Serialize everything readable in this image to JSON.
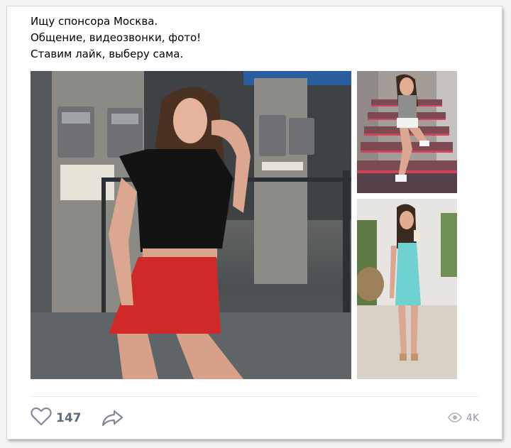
{
  "post": {
    "text_lines": [
      "Ищу спонсора Москва.",
      "Общение, видеозвонки, фото!",
      "Ставим лайк, выберу сама."
    ]
  },
  "photos": [
    {
      "description_icon": "photo-main"
    },
    {
      "description_icon": "photo-stairs"
    },
    {
      "description_icon": "photo-dress"
    }
  ],
  "footer": {
    "likes": "147",
    "views": "4K"
  },
  "colors": {
    "accent_gray": "#828a99",
    "count_color": "#5f6c7c",
    "views_color": "#939aa4"
  }
}
